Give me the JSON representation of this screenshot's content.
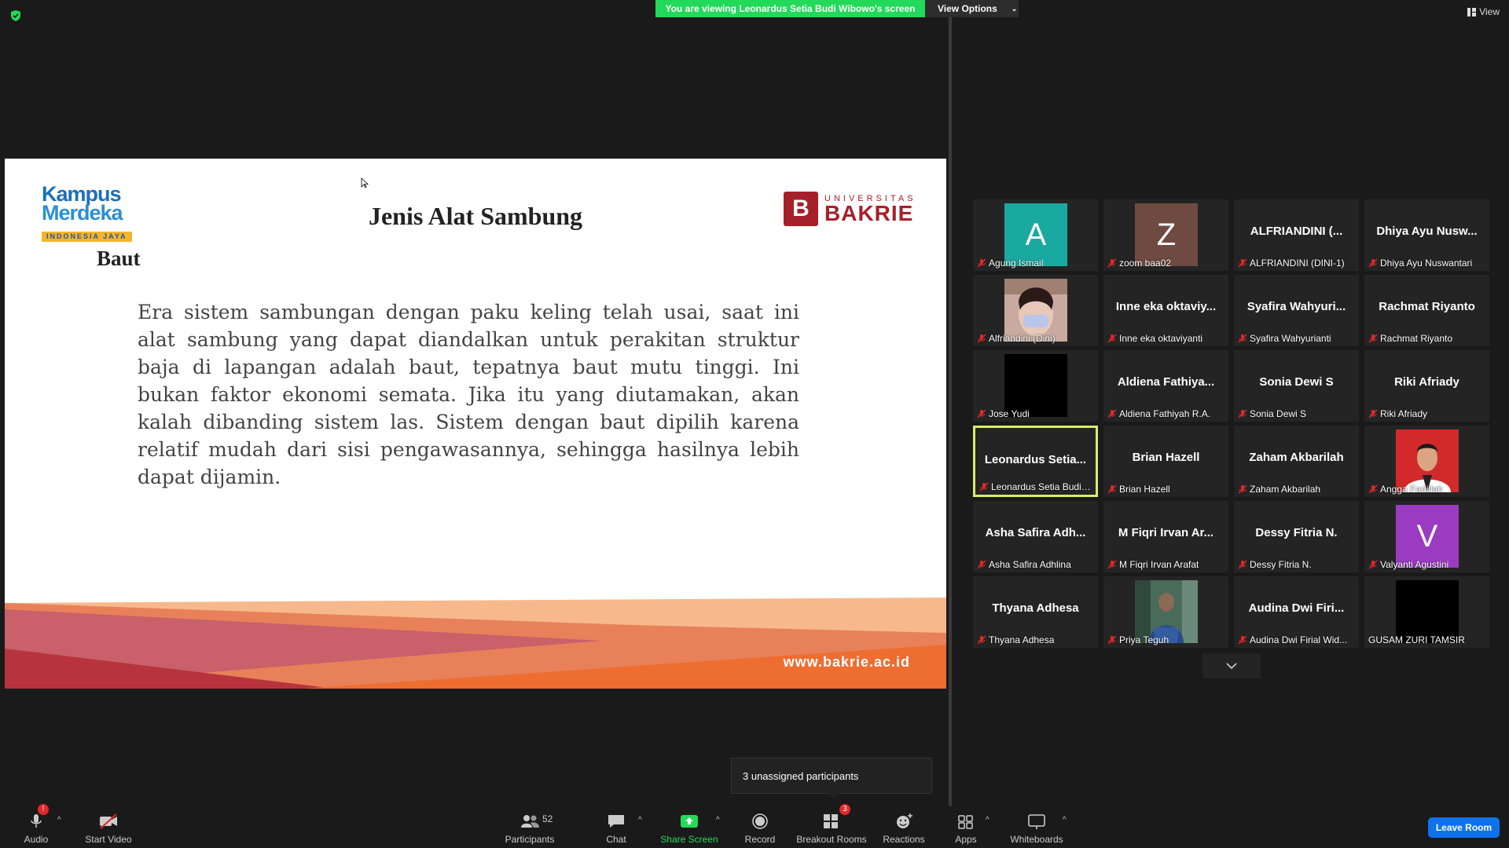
{
  "top": {
    "banner": "You are viewing Leonardus Setia Budi Wibowo's screen",
    "view_options": "View Options",
    "view": "View"
  },
  "slide": {
    "brand_left_line1": "Kampus",
    "brand_left_line2": "Merdeka",
    "brand_left_tag": "INDONESIA JAYA",
    "title": "Jenis Alat Sambung",
    "subtitle": "Baut",
    "body": "Era sistem sambungan dengan paku keling telah usai, saat ini alat sambung yang dapat diandalkan untuk perakitan struktur baja di lapangan adalah baut, tepatnya baut mutu tinggi. Ini bukan faktor ekonomi semata. Jika itu yang diutamakan, akan kalah dibanding sistem las. Sistem dengan baut dipilih karena relatif mudah dari sisi pengawasannya, sehingga hasilnya lebih dapat dijamin.",
    "univ_mark": "B",
    "univ_line1": "UNIVERSITAS",
    "univ_line2": "BAKRIE",
    "website": "www.bakrie.ac.id"
  },
  "tiles": [
    {
      "type": "letter",
      "letter": "A",
      "bg": "#1aa9a0",
      "name": "Agung Ismail"
    },
    {
      "type": "letter",
      "letter": "Z",
      "bg": "#6e4a40",
      "name": "zoom baa02"
    },
    {
      "type": "text",
      "big": "ALFRIANDINI (...",
      "name": "ALFRIANDINI (DINI-1)"
    },
    {
      "type": "text",
      "big": "Dhiya Ayu Nusw...",
      "name": "Dhiya Ayu Nuswantari"
    },
    {
      "type": "photo",
      "photo": "masked-face",
      "name": "Alfriandini (Dini)"
    },
    {
      "type": "text",
      "big": "Inne eka oktaviy...",
      "name": "Inne eka oktaviyanti"
    },
    {
      "type": "text",
      "big": "Syafira Wahyuri...",
      "name": "Syafira Wahyurianti"
    },
    {
      "type": "text",
      "big": "Rachmat Riyanto",
      "name": "Rachmat Riyanto"
    },
    {
      "type": "photo",
      "photo": "black",
      "name": "Jose Yudi"
    },
    {
      "type": "text",
      "big": "Aldiena Fathiya...",
      "name": "Aldiena Fathiyah R.A."
    },
    {
      "type": "text",
      "big": "Sonia Dewi S",
      "name": "Sonia Dewi S"
    },
    {
      "type": "text",
      "big": "Riki Afriady",
      "name": "Riki Afriady"
    },
    {
      "type": "text",
      "big": "Leonardus Setia...",
      "name": "Leonardus Setia Budi ...",
      "active": true
    },
    {
      "type": "text",
      "big": "Brian Hazell",
      "name": "Brian Hazell"
    },
    {
      "type": "text",
      "big": "Zaham Akbarilah",
      "name": "Zaham Akbarilah"
    },
    {
      "type": "photo",
      "photo": "red-portrait",
      "name": "Angga Fadillah"
    },
    {
      "type": "text",
      "big": "Asha Safira Adh...",
      "name": "Asha Safira Adhlina"
    },
    {
      "type": "text",
      "big": "M Fiqri Irvan Ar...",
      "name": "M Fiqri Irvan Arafat"
    },
    {
      "type": "text",
      "big": "Dessy Fitria N.",
      "name": "Dessy Fitria N."
    },
    {
      "type": "letter",
      "letter": "V",
      "bg": "#9b3bc2",
      "name": "Valyanti Agustini"
    },
    {
      "type": "text",
      "big": "Thyana Adhesa",
      "name": "Thyana Adhesa"
    },
    {
      "type": "photo",
      "photo": "outdoor",
      "name": "Priya Teguh"
    },
    {
      "type": "text",
      "big": "Audina Dwi Firi...",
      "name": "Audina Dwi Firial Wid..."
    },
    {
      "type": "photo",
      "photo": "black",
      "name": "GUSAM ZURI TAMSIR",
      "nomic": true
    }
  ],
  "tooltip": "3 unassigned participants",
  "toolbar": {
    "audio": "Audio",
    "audio_badge": "!",
    "start_video": "Start Video",
    "participants": "Participants",
    "participants_count": "52",
    "chat": "Chat",
    "share_screen": "Share Screen",
    "record": "Record",
    "breakout_rooms": "Breakout Rooms",
    "breakout_badge": "3",
    "reactions": "Reactions",
    "apps": "Apps",
    "whiteboards": "Whiteboards",
    "leave": "Leave Room"
  },
  "colors": {
    "share_green": "#23d959",
    "active_speaker": "#d8ed6a",
    "leave_blue": "#0e72ed",
    "mic_off_red": "#e02828"
  }
}
